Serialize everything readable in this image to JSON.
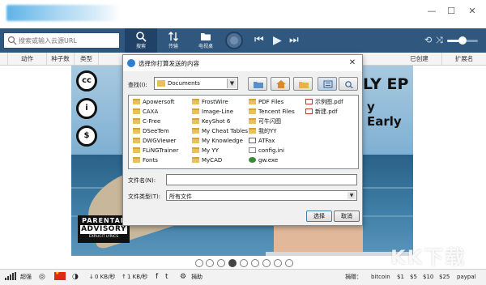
{
  "toolbar": {
    "search_placeholder": "搜索或输入云源URL",
    "buttons": [
      {
        "label": "搜索"
      },
      {
        "label": "传输"
      },
      {
        "label": "电视桌"
      }
    ]
  },
  "columns": {
    "action": "动作",
    "seeds": "种子数",
    "type": "类型",
    "completed": "已创建",
    "extension": "扩展名"
  },
  "media": {
    "album_title_line1": "LY EP",
    "album_title_line2": "y Early",
    "cc_badges": [
      "cc",
      "i",
      "$"
    ],
    "advisory": {
      "line1": "PARENTAL",
      "line2": "ADVISORY",
      "line3": "EXPLICIT LYRICS"
    }
  },
  "dialog": {
    "title": "选择你打算发送的内容",
    "look_in_label": "查找(I):",
    "look_in_value": "Documents",
    "files": [
      {
        "name": "Apowersoft",
        "kind": "folder"
      },
      {
        "name": "CAXA",
        "kind": "folder"
      },
      {
        "name": "C-Free",
        "kind": "folder"
      },
      {
        "name": "DSeeTem",
        "kind": "folder"
      },
      {
        "name": "DWGViewer",
        "kind": "folder"
      },
      {
        "name": "FLiNGTrainer",
        "kind": "folder"
      },
      {
        "name": "Fonts",
        "kind": "folder"
      },
      {
        "name": "FrostWire",
        "kind": "folder"
      },
      {
        "name": "Image-Line",
        "kind": "folder"
      },
      {
        "name": "KeyShot 6",
        "kind": "folder"
      },
      {
        "name": "My Cheat Tables",
        "kind": "folder"
      },
      {
        "name": "My Knowledge",
        "kind": "folder"
      },
      {
        "name": "My YY",
        "kind": "folder"
      },
      {
        "name": "MyCAD",
        "kind": "folder"
      },
      {
        "name": "PDF Files",
        "kind": "folder"
      },
      {
        "name": "Tencent Files",
        "kind": "folder"
      },
      {
        "name": "可牛闪图",
        "kind": "folder"
      },
      {
        "name": "我的YY",
        "kind": "folder"
      },
      {
        "name": "ATFax",
        "kind": "fax"
      },
      {
        "name": "config.ini",
        "kind": "ini"
      },
      {
        "name": "gw.exe",
        "kind": "exe"
      },
      {
        "name": "示例图.pdf",
        "kind": "pdf"
      },
      {
        "name": "新建.pdf",
        "kind": "pdf"
      }
    ],
    "file_name_label": "文件名(N):",
    "file_name_value": "",
    "file_type_label": "文件类型(T):",
    "file_type_value": "所有文件",
    "ok_label": "选择",
    "cancel_label": "取消"
  },
  "pager": {
    "count": 10,
    "active_index": 3
  },
  "statusbar": {
    "signal_label": "超强",
    "down_speed": "0 KB/秒",
    "up_speed": "1 KB/秒",
    "social_label": "捐助",
    "donate_label": "捐赠：",
    "donate_items": [
      "bitcoin",
      "$1",
      "$5",
      "$10",
      "$25",
      "paypal"
    ]
  },
  "watermark": {
    "text": "KK下载",
    "sub": "www.kkx.net"
  }
}
